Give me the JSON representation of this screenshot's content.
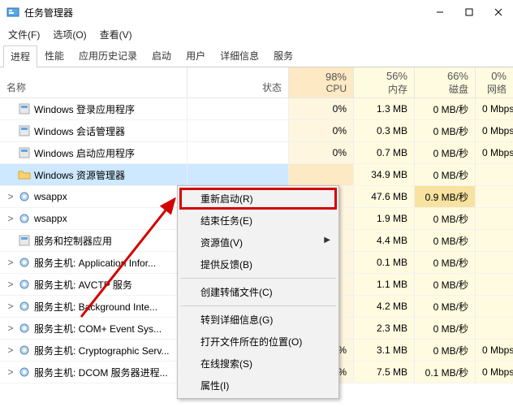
{
  "window": {
    "title": "任务管理器"
  },
  "menu": {
    "file": "文件(F)",
    "options": "选项(O)",
    "view": "查看(V)"
  },
  "tabs": [
    "进程",
    "性能",
    "应用历史记录",
    "启动",
    "用户",
    "详细信息",
    "服务"
  ],
  "headers": {
    "name": "名称",
    "status": "状态",
    "cpu_pct": "98%",
    "cpu": "CPU",
    "mem_pct": "56%",
    "mem": "内存",
    "disk_pct": "66%",
    "disk": "磁盘",
    "net_pct": "0%",
    "net": "网络"
  },
  "rows": [
    {
      "name": "Windows 登录应用程序",
      "cpu": "0%",
      "mem": "1.3 MB",
      "disk": "0 MB/秒",
      "net": "0 Mbps",
      "icon": "app"
    },
    {
      "name": "Windows 会话管理器",
      "cpu": "0%",
      "mem": "0.3 MB",
      "disk": "0 MB/秒",
      "net": "0 Mbps",
      "icon": "app"
    },
    {
      "name": "Windows 启动应用程序",
      "cpu": "0%",
      "mem": "0.7 MB",
      "disk": "0 MB/秒",
      "net": "0 Mbps",
      "icon": "app"
    },
    {
      "name": "Windows 资源管理器",
      "cpu": "",
      "mem": "34.9 MB",
      "disk": "0 MB/秒",
      "net": "",
      "icon": "folder",
      "selected": true
    },
    {
      "name": "wsappx",
      "cpu": "",
      "mem": "47.6 MB",
      "disk": "0.9 MB/秒",
      "net": "",
      "icon": "gear",
      "exp": true,
      "diskHot": true
    },
    {
      "name": "wsappx",
      "cpu": "",
      "mem": "1.9 MB",
      "disk": "0 MB/秒",
      "net": "",
      "icon": "gear",
      "exp": true
    },
    {
      "name": "服务和控制器应用",
      "cpu": "",
      "mem": "4.4 MB",
      "disk": "0 MB/秒",
      "net": "",
      "icon": "app"
    },
    {
      "name": "服务主机: Application Infor...",
      "cpu": "",
      "mem": "0.1 MB",
      "disk": "0 MB/秒",
      "net": "",
      "icon": "gear",
      "exp": true
    },
    {
      "name": "服务主机: AVCTP 服务",
      "cpu": "",
      "mem": "1.1 MB",
      "disk": "0 MB/秒",
      "net": "",
      "icon": "gear",
      "exp": true
    },
    {
      "name": "服务主机: Background Inte...",
      "cpu": "",
      "mem": "4.2 MB",
      "disk": "0 MB/秒",
      "net": "",
      "icon": "gear",
      "exp": true
    },
    {
      "name": "服务主机: COM+ Event Sys...",
      "cpu": "",
      "mem": "2.3 MB",
      "disk": "0 MB/秒",
      "net": "",
      "icon": "gear",
      "exp": true
    },
    {
      "name": "服务主机: Cryptographic Serv...",
      "cpu": "0%",
      "mem": "3.1 MB",
      "disk": "0 MB/秒",
      "net": "0 Mbps",
      "icon": "gear",
      "exp": true
    },
    {
      "name": "服务主机: DCOM 服务器进程...",
      "cpu": "0%",
      "mem": "7.5 MB",
      "disk": "0.1 MB/秒",
      "net": "0 Mbps",
      "icon": "gear",
      "exp": true
    }
  ],
  "context_menu": {
    "restart": "重新启动(R)",
    "end_task": "结束任务(E)",
    "resource_values": "资源值(V)",
    "feedback": "提供反馈(B)",
    "create_dump": "创建转储文件(C)",
    "details": "转到详细信息(G)",
    "open_location": "打开文件所在的位置(O)",
    "search_online": "在线搜索(S)",
    "properties": "属性(I)"
  }
}
